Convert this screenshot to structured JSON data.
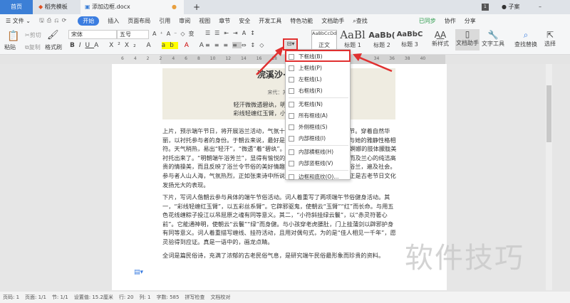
{
  "tabs": [
    {
      "label": "首页"
    },
    {
      "label": "稻壳模板"
    },
    {
      "label": "添加边框.docx"
    }
  ],
  "titlebar": {
    "badge": "1",
    "user": "子案"
  },
  "menu": [
    "文件",
    "开始",
    "插入",
    "页面布局",
    "引用",
    "审阅",
    "视图",
    "章节",
    "安全",
    "开发工具",
    "特色功能",
    "文档助手",
    "查找"
  ],
  "menu_right": [
    "已同步",
    "协作",
    "分享"
  ],
  "ribbon": {
    "paste": "粘贴",
    "cut": "剪切",
    "copy": "复制",
    "format_painter": "格式刷",
    "font": "宋体",
    "size": "五号",
    "styles": [
      {
        "preview": "AaBbCcDd",
        "label": "正文"
      },
      {
        "preview": "AaBl",
        "label": "标题 1"
      },
      {
        "preview": "AaBb(",
        "label": "标题 2"
      },
      {
        "preview": "AaBbC",
        "label": "标题 3"
      }
    ],
    "new_style": "新样式",
    "doc_assistant": "文档助手",
    "text_tools": "文字工具",
    "find_replace": "查找替换",
    "select": "选择"
  },
  "ruler": [
    "6",
    "4",
    "2",
    "2",
    "4",
    "6",
    "8",
    "10",
    "12",
    "14",
    "16",
    "18",
    "20",
    "34",
    "36",
    "38",
    "40"
  ],
  "doc": {
    "title": "浣溪沙·端午",
    "author": "宋代：苏轼",
    "verse1": "轻汗微微透碧纨，明朝端午浴芳兰。",
    "verse2": "彩线轻缠红玉臂，小符斜挂绿云鬟。",
    "para1": "上片，预示端午节日，将开展浴兰活动，气氛十分热烈，时令正值初夏季节。穿着自然华丽，以衬托参与者的身份。于朝云来说，最好是穿上碧纨做成的衣服，这与她的雅静性格相符。天气稍热，易出“轻汗”，“微透”着“碧纨”。这是用细腻的笔触将朝云婀娜的肢体朦胧美衬托出来了。“明朝端午浴芳兰”，显得有愉悦的画面，不仅写出了由芳体而及兰心的纯洁高贵的情操美，而且反映了浴兰令节俗的美好情趣，至今仍余香犹存。沐芳浴兰，遍及社会。参与者人山人海，气氛热烈，正如张耒诗中所说的“流香涨腻满晴川”。这正是古老节日文化发扬光大的表现。",
    "para2": "下片，写词人偕朝云参与具体的端午节俗活动。词人着重写了两项端午节俗健身活动。其一，“彩线轻缠红玉臂”，以五彩丝系臂”。它辟邪驱鬼，使朝云“玉臂”“红”而长命。与用五色花线缠粽子投江以吊屈原之魂有同等意义。其二，“小符斜挂绿云鬟”，以“赤灵符著心前”。它能通神明，使朝云“云鬟”“绿”而身健。与小孩穿老虎腰肚，门上挂蒲剑以辟邪护身有同等意义。词人着重描写缠线、挂符活动，且用对偶句式，为的是“佳人相见一千年”，愿灵验得到应证。真是一语中的，画龙点睛。",
    "para3": "全词是篇民俗诗，充满了浓郁的古老民俗气息，是研究端午民俗最形象而珍贵的资料。"
  },
  "border_menu": [
    "下框线(B)",
    "上框线(P)",
    "左框线(L)",
    "右框线(R)",
    "无框线(N)",
    "所有框线(A)",
    "外侧框线(S)",
    "内部框线(I)",
    "内部横框线(H)",
    "内部竖框线(V)",
    "边框和底纹(O)..."
  ],
  "status": [
    "页码: 1",
    "页面: 1/1",
    "节: 1/1",
    "设置值: 15.2厘米",
    "行: 20",
    "列: 1",
    "字数: 585",
    "拼写检查",
    "文档校对"
  ],
  "watermark": "软件技巧",
  "colors": {
    "accent": "#3b7de0",
    "highlight": "#e03030"
  }
}
